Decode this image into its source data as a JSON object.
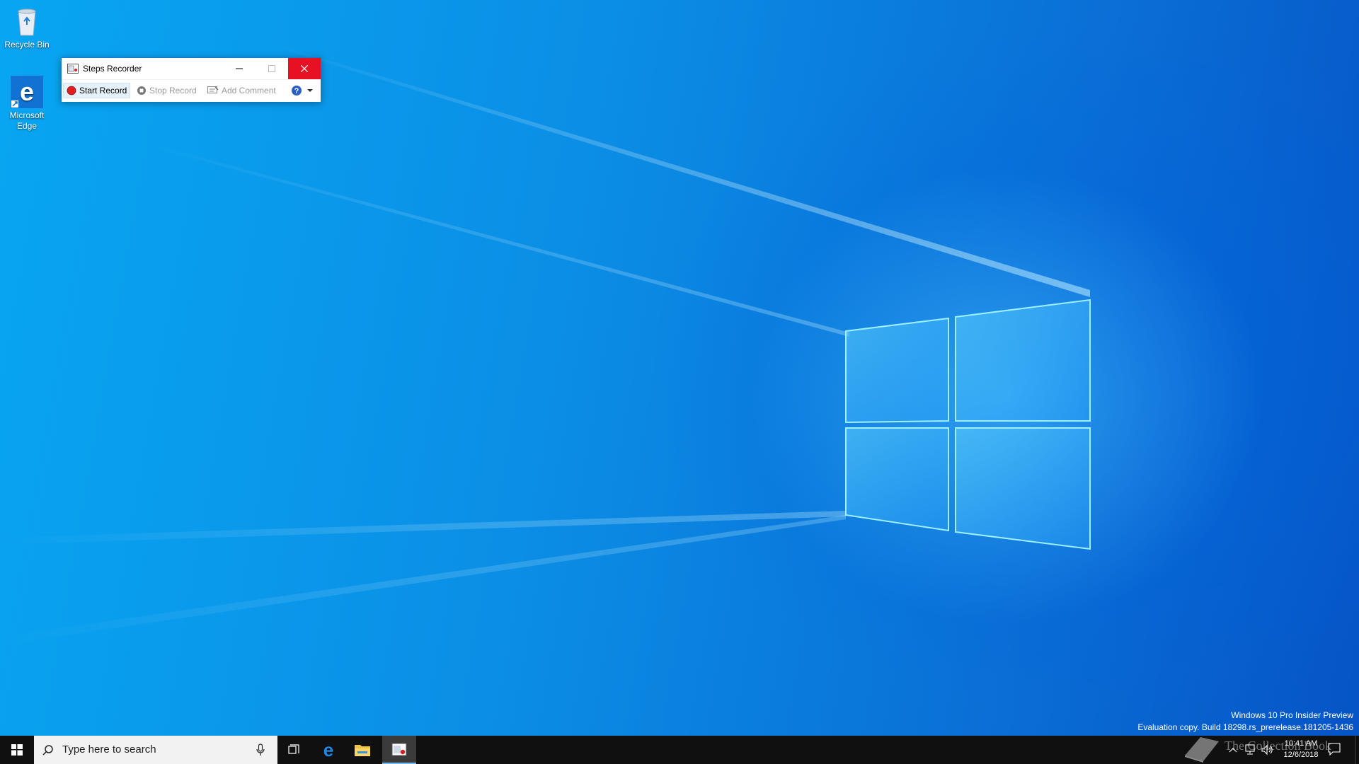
{
  "desktop": {
    "icons": [
      {
        "label": "Recycle Bin"
      },
      {
        "label_line1": "Microsoft",
        "label_line2": "Edge"
      }
    ]
  },
  "window": {
    "title": "Steps Recorder",
    "toolbar": {
      "start_record": "Start Record",
      "stop_record": "Stop Record",
      "add_comment": "Add Comment"
    }
  },
  "watermark": {
    "line1": "Windows 10 Pro Insider Preview",
    "line2": "Evaluation copy. Build 18298.rs_prerelease.181205-1436"
  },
  "taskbar": {
    "search_placeholder": "Type here to search",
    "time": "10:41 AM",
    "date": "12/6/2018",
    "overlay_text": "The Collection Book"
  },
  "colors": {
    "accent": "#0078d7",
    "close_button": "#e81123",
    "record_red": "#e02020"
  }
}
